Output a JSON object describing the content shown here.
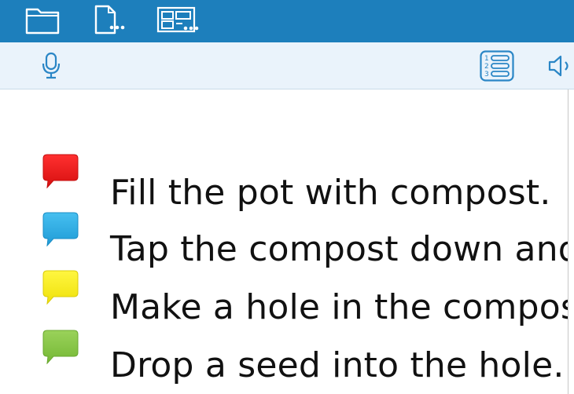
{
  "topbar": {
    "color": "#1d7fbc",
    "icons": [
      "folder-icon",
      "file-more-icon",
      "layout-more-icon"
    ]
  },
  "toolbar": {
    "color": "#eaf3fb",
    "icons": [
      "microphone-icon",
      "numbered-list-icon",
      "speaker-icon"
    ],
    "list_numbers": [
      "1",
      "2",
      "3"
    ]
  },
  "steps": [
    {
      "text": "Fill the pot with compost.",
      "color": "#ee1c1c"
    },
    {
      "text": "Tap the compost down and",
      "color": "#2aa9e0"
    },
    {
      "text": "Make a hole in the compost",
      "color": "#f4ec13"
    },
    {
      "text": "Drop a seed into the hole.",
      "color": "#84c440"
    }
  ]
}
